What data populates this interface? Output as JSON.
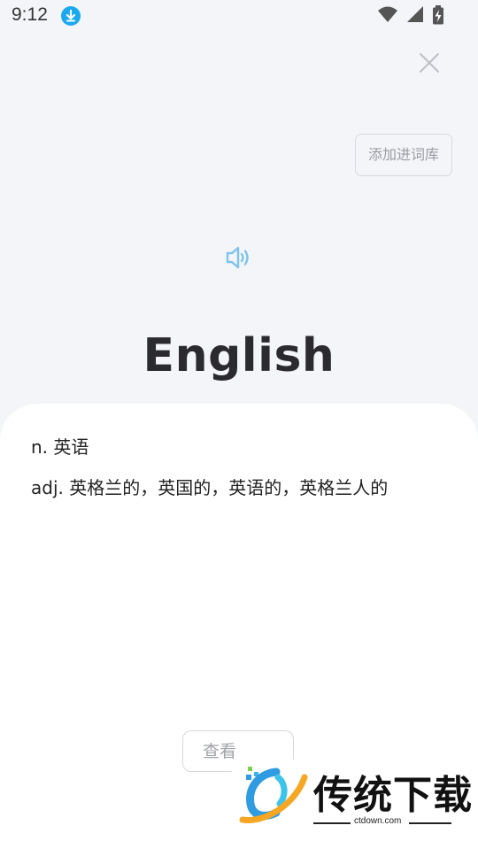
{
  "status_bar": {
    "time": "9:12",
    "download_icon": "download-arrow-icon",
    "wifi_icon": "wifi-icon",
    "signal_icon": "cell-signal-icon",
    "battery_icon": "battery-charging-icon"
  },
  "header": {
    "close_icon": "close-icon",
    "add_to_wordbook_label": "添加进词库"
  },
  "word_card": {
    "speaker_icon": "speaker-icon",
    "word": "English"
  },
  "definitions": [
    "n. 英语",
    "adj. 英格兰的，英国的，英语的，英格兰人的"
  ],
  "footer": {
    "view_more_label": "查看"
  },
  "watermark": {
    "brand": "传统下载",
    "url": "ctdown.com"
  },
  "colors": {
    "background": "#f4f5f9",
    "accent_blue": "#1aa8ef",
    "speaker_blue": "#7cc4ee",
    "word_text": "#2b2b2f"
  }
}
